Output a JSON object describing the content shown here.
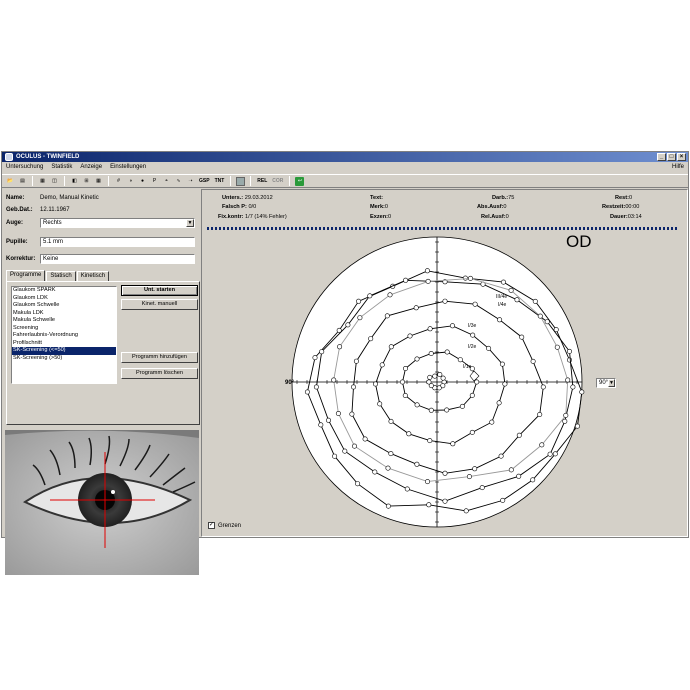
{
  "window": {
    "title": "OCULUS - TWINFIELD"
  },
  "menu": {
    "items": [
      "Untersuchung",
      "Statistik",
      "Anzeige",
      "Einstellungen"
    ],
    "help": "Hilfe"
  },
  "toolbar": {
    "btn_gsp": "GSP",
    "btn_tnt": "TNT",
    "btn_rel": "REL",
    "btn_cor": "COR"
  },
  "patient": {
    "name_label": "Name:",
    "name": "Demo, Manual Kinetic",
    "dob_label": "Geb.Dat.:",
    "dob": "12.11.1967",
    "eye_label": "Auge:",
    "eye": "Rechts",
    "pupil_label": "Pupille:",
    "pupil": "5.1 mm",
    "corr_label": "Korrektur:",
    "corr": "Keine"
  },
  "tabs": [
    "Programme",
    "Statisch",
    "Kinetisch"
  ],
  "programs": [
    "Glaukom SPARK",
    "Glaukom LDK",
    "Glaukom Schwelle",
    "Makula LDK",
    "Makula Schwelle",
    "Screening",
    "Fahrerlaubnis-Verordnung",
    "Profilschnitt",
    "SK-Screening (<=50)",
    "SK-Screening (>50)"
  ],
  "selected_program_index": 8,
  "buttons": {
    "start": "Unt. starten",
    "kinet": "Kinet. manuell",
    "add": "Programm hinzufügen",
    "delete": "Programm löschen"
  },
  "stats": {
    "unters_label": "Unters.:",
    "unters": "29.03.2012",
    "falsch_label": "Falsch P:",
    "falsch": "0/0",
    "fix_label": "Fix.kontr:",
    "fix": "1/7 (14% Fehler)",
    "text_label": "Text:",
    "text": "",
    "merk_label": "Merk:",
    "merk": "0",
    "exzen_label": "Exzen:",
    "exzen": "0",
    "darb_label": "Darb.:",
    "darb": "75",
    "abs_label": "Abs.Ausf:",
    "abs": "0",
    "rel_label": "Rel.Ausf:",
    "rel": "0",
    "rest_label": "Rest:",
    "rest": "0",
    "restzeit_label": "Restzeit:",
    "restzeit": "00:00",
    "dauer_label": "Dauer:",
    "dauer": "03:14"
  },
  "eye_side": "OD",
  "axis_label_90": "90°",
  "isopter_labels": [
    "III/4e",
    "I/4e",
    "I/3e",
    "I/2e",
    "I/1e"
  ],
  "angle_select": "90°",
  "grenzen": {
    "label": "Grenzen",
    "checked": true
  }
}
